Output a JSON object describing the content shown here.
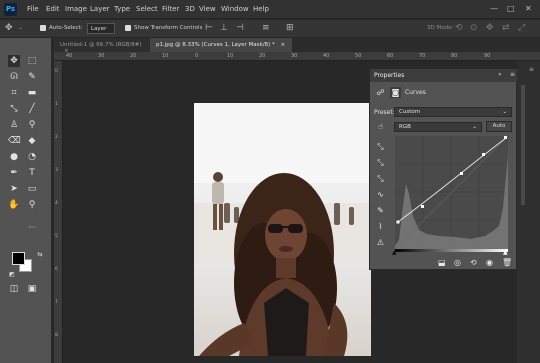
{
  "app": {
    "logo": "Ps"
  },
  "menu": [
    "File",
    "Edit",
    "Image",
    "Layer",
    "Type",
    "Select",
    "Filter",
    "3D",
    "View",
    "Window",
    "Help"
  ],
  "window_controls": {
    "minimize": "—",
    "maximize": "□",
    "close": "✕"
  },
  "options": {
    "auto_select_label": "Auto-Select:",
    "auto_select_value": "Layer",
    "transform_label": "Show Transform Controls",
    "mode_3d": "3D Mode:"
  },
  "tabs": [
    {
      "label": "Untitled-1 @ 66.7% (RGB/8#)",
      "close": "×"
    },
    {
      "label": "p1.jpg @ 8.33% (Curves 1, Layer Mask/8) *",
      "close": "×"
    }
  ],
  "ruler": {
    "top": [
      "40",
      "30",
      "20",
      "10",
      "0",
      "10",
      "20",
      "30",
      "40",
      "50",
      "60",
      "70",
      "80",
      "90"
    ],
    "left": [
      "0",
      "1",
      "2",
      "3",
      "4",
      "5",
      "6",
      "7",
      "8"
    ]
  },
  "properties": {
    "title": "Properties",
    "adjustment": "Curves",
    "preset_label": "Preset:",
    "preset_value": "Custom",
    "channel_value": "RGB",
    "auto_button": "Auto",
    "collapse": "»",
    "menu_glyph": "≡"
  },
  "colors": {
    "foreground": "#000000",
    "background": "#ffffff",
    "panel": "#535353",
    "accent": "#31a8ff"
  },
  "icons": {
    "move": "move-icon",
    "marquee": "marquee-icon",
    "lasso": "lasso-icon",
    "quick-select": "quick-select-icon",
    "crop": "crop-icon",
    "eyedropper": "eyedropper-icon",
    "healing": "healing-brush-icon",
    "brush": "brush-icon",
    "stamp": "clone-stamp-icon",
    "history": "history-brush-icon",
    "eraser": "eraser-icon",
    "bucket": "paint-bucket-icon",
    "blur": "blur-icon",
    "dodge": "dodge-icon",
    "pen": "pen-icon",
    "type": "type-icon",
    "path": "path-select-icon",
    "shape": "rectangle-icon",
    "hand": "hand-icon",
    "zoom": "zoom-icon"
  }
}
